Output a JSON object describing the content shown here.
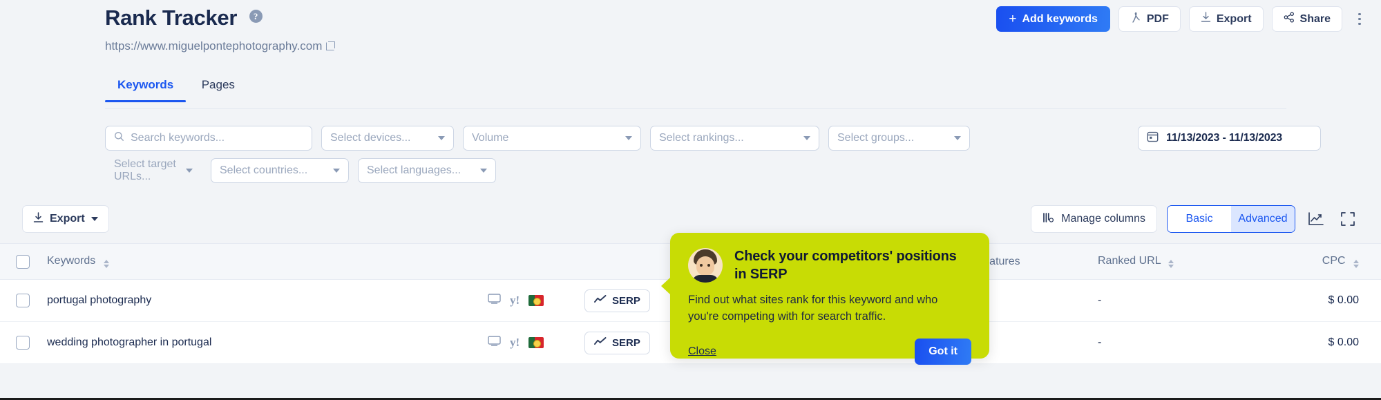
{
  "header": {
    "title": "Rank Tracker",
    "help_icon": "question-circle-icon",
    "site_url": "https://www.miguelpontephotography.com",
    "external_link_icon": "external-link-icon",
    "actions": {
      "add_keywords": "Add keywords",
      "add_keywords_plus": "+",
      "pdf": "PDF",
      "export": "Export",
      "share": "Share",
      "more_icon": "kebab-menu-icon"
    }
  },
  "tabs": [
    {
      "label": "Keywords",
      "active": true
    },
    {
      "label": "Pages",
      "active": false
    }
  ],
  "filters": {
    "search_placeholder": "Search keywords...",
    "devices": "Select devices...",
    "volume": "Volume",
    "rankings": "Select rankings...",
    "groups": "Select groups...",
    "target_urls": "Select target URLs...",
    "countries": "Select countries...",
    "languages": "Select languages...",
    "date_range": "11/13/2023 - 11/13/2023",
    "calendar_icon": "calendar-icon",
    "search_icon": "search-icon"
  },
  "actionbar": {
    "export": "Export",
    "manage_columns": "Manage columns",
    "segment": {
      "basic": "Basic",
      "advanced": "Advanced",
      "selected": "Advanced"
    },
    "chart_icon": "line-chart-icon",
    "fullscreen_icon": "fullscreen-icon"
  },
  "table": {
    "columns": {
      "keywords": "Keywords",
      "serp_features": "P features",
      "ranked_url": "Ranked URL",
      "cpc": "CPC"
    },
    "serp_button_label": "SERP",
    "rows": [
      {
        "keyword": "portugal photography",
        "device_icon": "desktop-icon",
        "engine_icon": "yahoo-icon",
        "country_flag": "portugal-flag",
        "ranked_url": "-",
        "cpc": "$ 0.00"
      },
      {
        "keyword": "wedding photographer in portugal",
        "device_icon": "desktop-icon",
        "engine_icon": "yahoo-icon",
        "country_flag": "portugal-flag",
        "ranked_url": "-",
        "cpc": "$ 0.00"
      }
    ]
  },
  "popover": {
    "title": "Check your competitors' positions in SERP",
    "body": "Find out what sites rank for this keyword and who you're competing with for search traffic.",
    "close": "Close",
    "confirm": "Got it",
    "avatar": "user-avatar",
    "background_color": "#c8dc05"
  },
  "colors": {
    "accent_blue": "#1a56f0",
    "page_background": "#f2f4f7",
    "popover_green": "#c8dc05",
    "text_dark": "#1a2a4f"
  }
}
